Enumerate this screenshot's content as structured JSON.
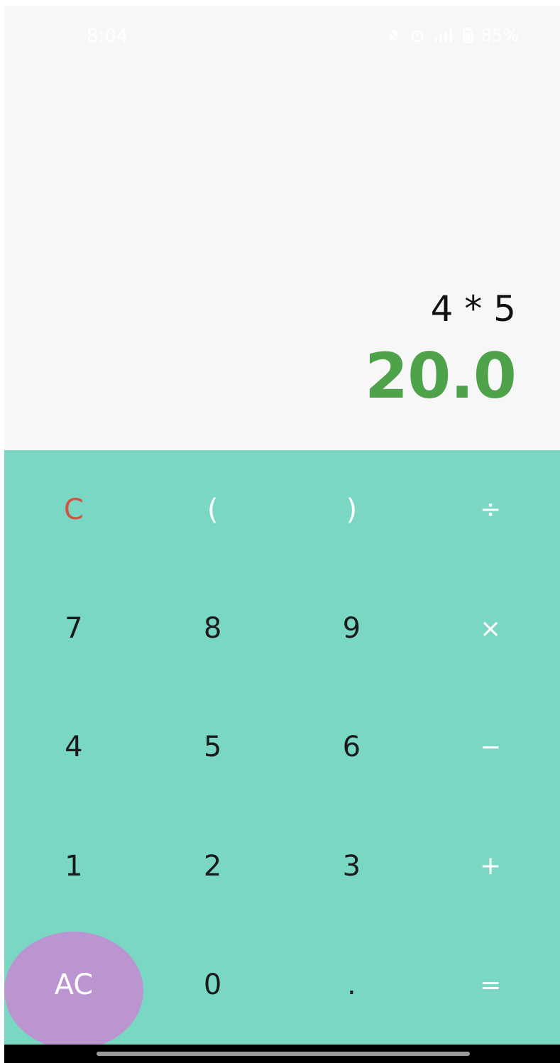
{
  "status_bar": {
    "time": "8:04",
    "battery": "85%",
    "icons": [
      "mute-icon",
      "alarm-icon",
      "signal-icon",
      "battery-icon"
    ]
  },
  "display": {
    "expression": "4 * 5",
    "result": "20.0"
  },
  "keypad": {
    "rows": [
      [
        "C",
        "(",
        ")",
        "÷"
      ],
      [
        "7",
        "8",
        "9",
        "×"
      ],
      [
        "4",
        "5",
        "6",
        "−"
      ],
      [
        "1",
        "2",
        "3",
        "+"
      ],
      [
        "AC",
        "0",
        ".",
        "="
      ]
    ]
  },
  "colors": {
    "keypad_background": "#79d7c4",
    "result_text": "#4ea24a",
    "clear_key": "#d4523f",
    "ac_bubble": "#ba95cf",
    "display_background": "#f7f7f7"
  }
}
